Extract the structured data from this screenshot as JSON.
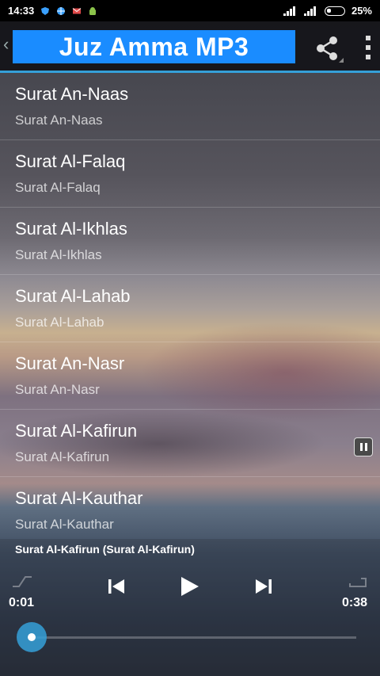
{
  "status": {
    "time": "14:33",
    "battery": "25%"
  },
  "header": {
    "back_glyph": "‹",
    "title": "Juz Amma MP3",
    "share_icon": "share-icon",
    "menu_icon": "overflow-menu-icon"
  },
  "list": {
    "items": [
      {
        "title": "Surat An-Naas",
        "subtitle": "Surat An-Naas"
      },
      {
        "title": "Surat Al-Falaq",
        "subtitle": "Surat Al-Falaq"
      },
      {
        "title": "Surat Al-Ikhlas",
        "subtitle": "Surat Al-Ikhlas"
      },
      {
        "title": "Surat Al-Lahab",
        "subtitle": "Surat Al-Lahab"
      },
      {
        "title": "Surat An-Nasr",
        "subtitle": "Surat An-Nasr"
      },
      {
        "title": "Surat Al-Kafirun",
        "subtitle": "Surat Al-Kafirun"
      },
      {
        "title": "Surat Al-Kauthar",
        "subtitle": "Surat Al-Kauthar"
      }
    ]
  },
  "player": {
    "now_playing": "Surat Al-Kafirun (Surat Al-Kafirun)",
    "elapsed": "0:01",
    "duration": "0:38",
    "progress_fraction": 0.03,
    "accent": "#35a0d8"
  },
  "colors": {
    "title_bg": "#1a8cff",
    "accent": "#35a0d8"
  }
}
